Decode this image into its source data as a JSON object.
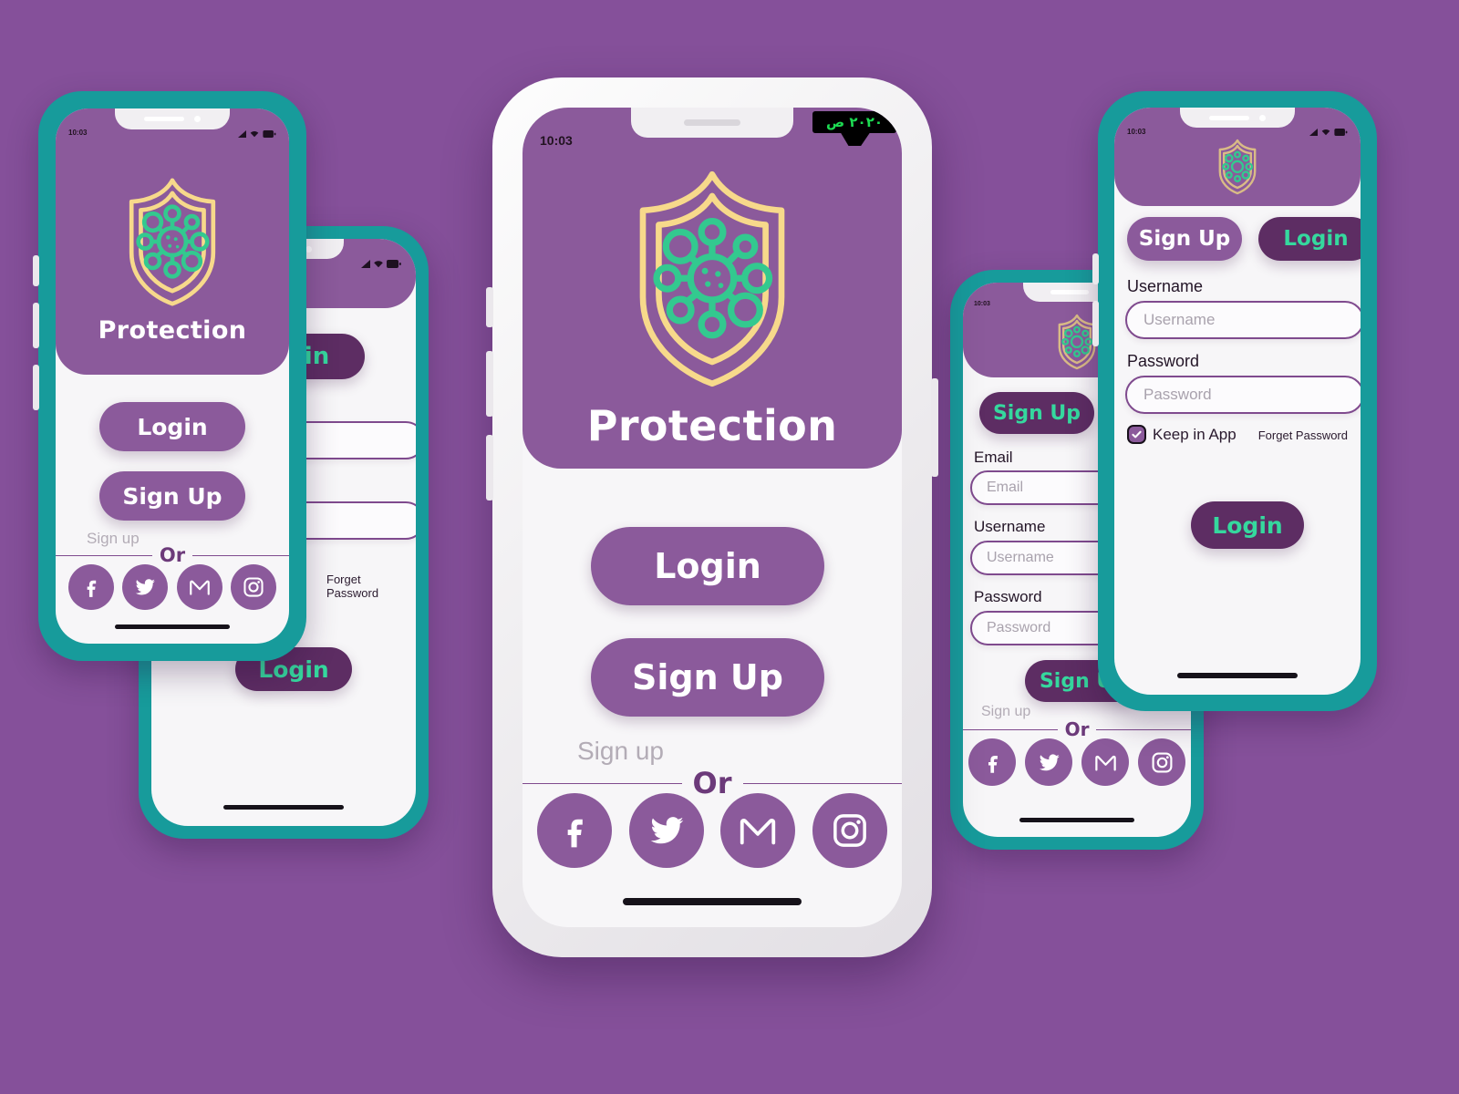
{
  "app": {
    "brand_name": "Protection",
    "background_color": "#85509a",
    "accent_purple": "#8b5a9b",
    "accent_dark_purple": "#5d2d63",
    "accent_green": "#35d89e",
    "accent_teal": "#179b9b",
    "shield_color": "#f7d98b",
    "logo_icon": "shield-virus-icon"
  },
  "status_bar": {
    "time": "10:03",
    "icons": [
      "signal-icon",
      "wifi-icon",
      "battery-icon"
    ]
  },
  "watermark": {
    "text": "٢٠٢٠ ص"
  },
  "labels": {
    "login": "Login",
    "sign_up": "Sign Up",
    "or": "Or",
    "sign_up_ghost": "Sign up",
    "username": "Username",
    "password": "Password",
    "email": "Email",
    "keep_in_app": "Keep in App",
    "forget_password": "Forget Password"
  },
  "placeholders": {
    "username": "Username",
    "password": "Password",
    "email": "Email"
  },
  "socials": [
    {
      "name": "facebook-icon",
      "label": "Facebook"
    },
    {
      "name": "twitter-icon",
      "label": "Twitter"
    },
    {
      "name": "gmail-icon",
      "label": "Gmail"
    },
    {
      "name": "instagram-icon",
      "label": "Instagram"
    }
  ],
  "screens": {
    "welcome_left": {
      "title": "Protection",
      "primary_button": "Login",
      "secondary_button": "Sign Up",
      "divider_ghost": "Sign up",
      "divider": "Or"
    },
    "login_back": {
      "tab_login": "Login",
      "forget_password": "Forget Password",
      "submit": "Login"
    },
    "welcome_main": {
      "title": "Protection",
      "time": "10:03",
      "primary_button": "Login",
      "secondary_button": "Sign Up",
      "divider_ghost": "Sign up",
      "divider": "Or"
    },
    "signup_form": {
      "tab_signup": "Sign Up",
      "fields": [
        {
          "label": "Email",
          "placeholder": "Email"
        },
        {
          "label": "Username",
          "placeholder": "Username"
        },
        {
          "label": "Password",
          "placeholder": "Password"
        }
      ],
      "submit": "Sign Up",
      "divider_ghost": "Sign up",
      "divider": "Or"
    },
    "login_form": {
      "time": "10:03",
      "tab_signup": "Sign Up",
      "tab_login": "Login",
      "fields": [
        {
          "label": "Username",
          "placeholder": "Username"
        },
        {
          "label": "Password",
          "placeholder": "Password"
        }
      ],
      "keep_in_app": "Keep in App",
      "keep_in_app_checked": true,
      "forget_password": "Forget Password",
      "submit": "Login"
    }
  }
}
